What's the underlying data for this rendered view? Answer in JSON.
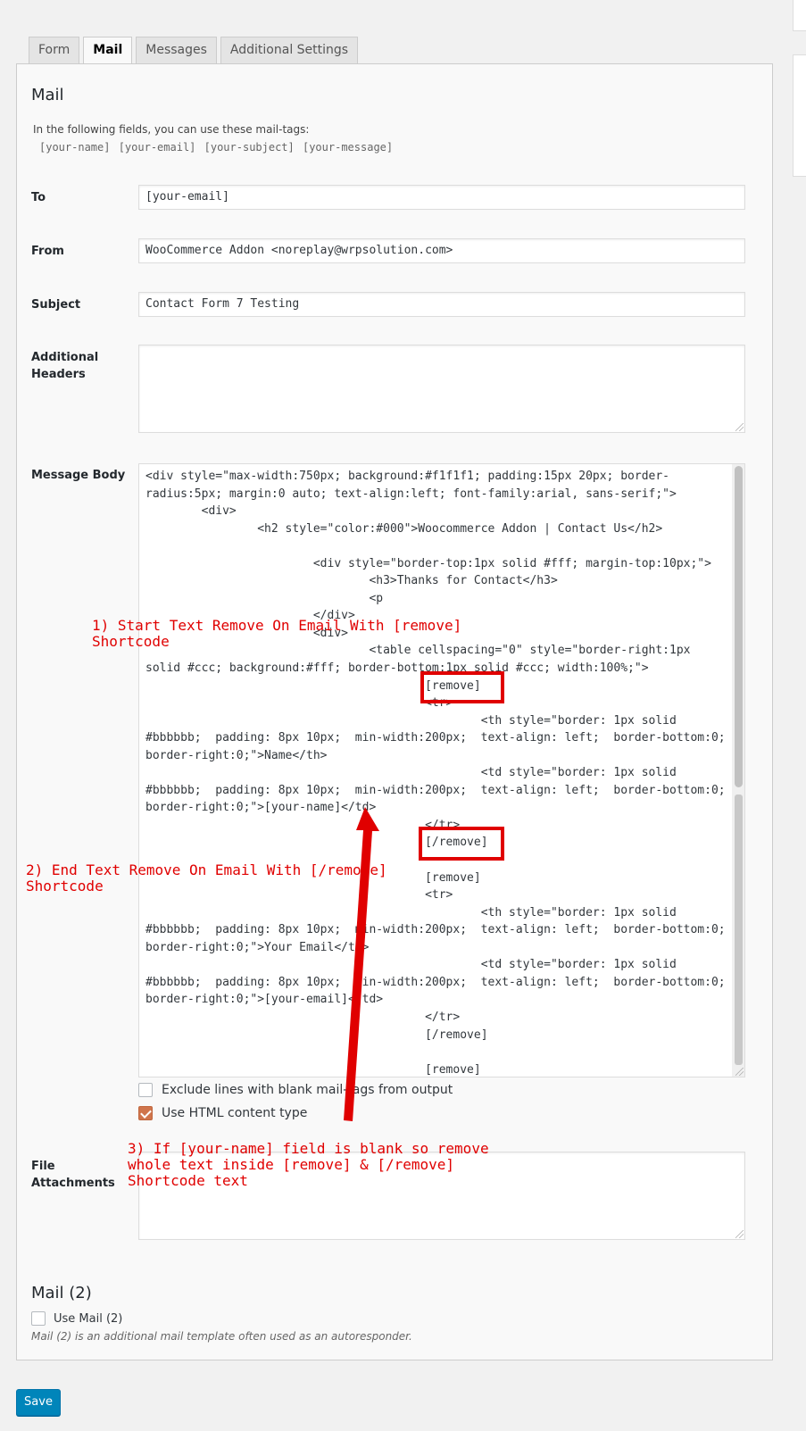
{
  "tabs": [
    "Form",
    "Mail",
    "Messages",
    "Additional Settings"
  ],
  "active_tab": "Mail",
  "mail": {
    "title": "Mail",
    "hint": "In the following fields, you can use these mail-tags:",
    "tags": "[your-name] [your-email] [your-subject] [your-message]",
    "to_label": "To",
    "to_value": "[your-email]",
    "from_label": "From",
    "from_value": "WooCommerce Addon <noreplay@wrpsolution.com>",
    "subject_label": "Subject",
    "subject_value": "Contact Form 7 Testing",
    "headers_label": "Additional Headers",
    "headers_value": "",
    "body_label": "Message Body",
    "body_value": "<div style=\"max-width:750px; background:#f1f1f1; padding:15px 20px; border-radius:5px; margin:0 auto; text-align:left; font-family:arial, sans-serif;\">\n        <div>\n                <h2 style=\"color:#000\">Woocommerce Addon | Contact Us</h2>\n\n                        <div style=\"border-top:1px solid #fff; margin-top:10px;\">\n                                <h3>Thanks for Contact</h3>\n                                <p\n                        </div>\n                        <div>\n                                <table cellspacing=\"0\" style=\"border-right:1px solid #ccc; background:#fff; border-bottom:1px solid #ccc; width:100%;\">\n                                        [remove]\n                                        <tr>\n                                                <th style=\"border: 1px solid #bbbbbb;  padding: 8px 10px;  min-width:200px;  text-align: left;  border-bottom:0;  border-right:0;\">Name</th>\n                                                <td style=\"border: 1px solid #bbbbbb;  padding: 8px 10px;  min-width:200px;  text-align: left;  border-bottom:0;  border-right:0;\">[your-name]</td>\n                                        </tr>\n                                        [/remove]\n\n                                        [remove]\n                                        <tr>\n                                                <th style=\"border: 1px solid #bbbbbb;  padding: 8px 10px;  min-width:200px;  text-align: left;  border-bottom:0;  border-right:0;\">Your Email</th>\n                                                <td style=\"border: 1px solid #bbbbbb;  padding: 8px 10px;  min-width:200px;  text-align: left;  border-bottom:0;  border-right:0;\">[your-email]</td>\n                                        </tr>\n                                        [/remove]\n\n                                        [remove]",
    "exclude_label": "Exclude lines with blank mail-tags from output",
    "exclude_checked": false,
    "html_label": "Use HTML content type",
    "html_checked": true,
    "attachments_label": "File Attachments",
    "attachments_value": ""
  },
  "mail2": {
    "title": "Mail (2)",
    "use_label": "Use Mail (2)",
    "use_checked": false,
    "note": "Mail (2) is an additional mail template often used as an autoresponder."
  },
  "save_label": "Save",
  "annotations": {
    "a1": "1) Start Text Remove On Email With [remove]\nShortcode",
    "a2": "2) End Text Remove On Email With [/remove]\nShortcode",
    "a3": "3) If [your-name] field is blank so remove\nwhole text inside [remove] & [/remove]\nShortcode text",
    "color": "#e00000"
  },
  "accent_color": "#0085ba"
}
